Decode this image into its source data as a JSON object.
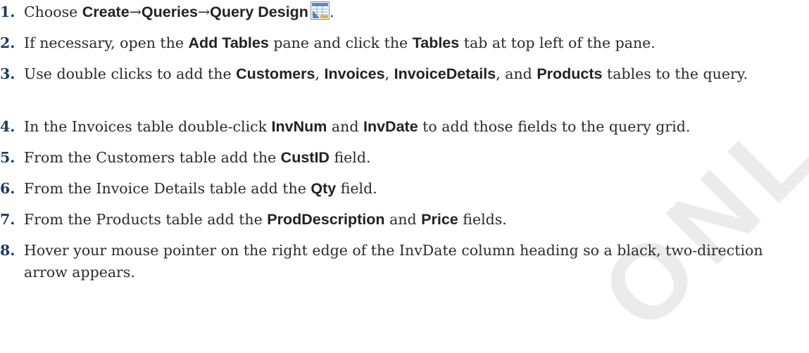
{
  "watermark": "ONL",
  "steps": [
    {
      "num": "1.",
      "t0": "Choose ",
      "b1": "Create",
      "arrow1": "→",
      "b2": "Queries",
      "arrow2": "→",
      "b3": "Query Design",
      "tail": ".",
      "icon": "query-design-icon"
    },
    {
      "num": "2.",
      "t0": "If necessary, open the ",
      "b1": "Add Tables",
      "t1": " pane and click the ",
      "b2": "Tables",
      "t2": " tab at top left of the pane."
    },
    {
      "num": "3.",
      "t0": "Use double clicks to add the ",
      "b1": "Customers",
      "t1": ", ",
      "b2": "Invoices",
      "t2": ", ",
      "b3": "InvoiceDetails",
      "t3": ", and ",
      "b4": "Products",
      "t4": " tables to the query."
    },
    {
      "num": "4.",
      "t0": "In the Invoices table double-click ",
      "b1": "InvNum",
      "t1": " and ",
      "b2": "InvDate",
      "t2": " to add those fields to the query grid."
    },
    {
      "num": "5.",
      "t0": "From the Customers table add the ",
      "b1": "CustID",
      "t1": " field."
    },
    {
      "num": "6.",
      "t0": "From the Invoice Details table add the ",
      "b1": "Qty",
      "t1": " field."
    },
    {
      "num": "7.",
      "t0": "From the Products table add the ",
      "b1": "ProdDescription",
      "t1": " and ",
      "b2": "Price",
      "t2": " fields."
    },
    {
      "num": "8.",
      "t0": "Hover your mouse pointer on the right edge of the InvDate column heading so a black, two-direction arrow appears."
    }
  ]
}
